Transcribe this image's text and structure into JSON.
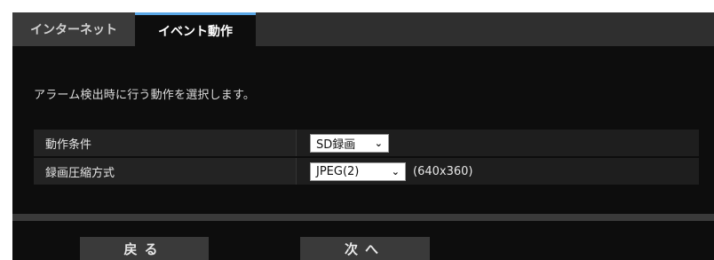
{
  "tabs": [
    {
      "label": "インターネット",
      "active": false
    },
    {
      "label": "イベント動作",
      "active": true
    }
  ],
  "description": "アラーム検出時に行う動作を選択します。",
  "settings": [
    {
      "label": "動作条件",
      "value": "SD録画",
      "suffix": ""
    },
    {
      "label": "録画圧縮方式",
      "value": "JPEG(2)",
      "suffix": "(640x360)"
    }
  ],
  "buttons": {
    "back": "戻る",
    "next": "次へ"
  },
  "colors": {
    "panel_bg": "#0d0d0d",
    "tab_accent": "#5aa7e6",
    "row_label_bg": "#232323",
    "button_bg": "#3a3a3a"
  }
}
